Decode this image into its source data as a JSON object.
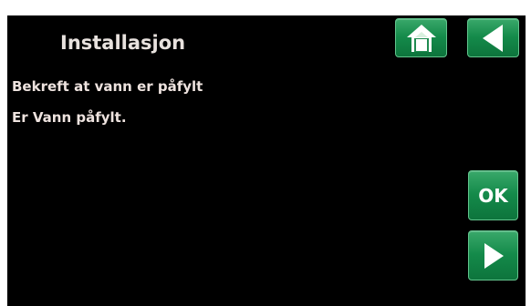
{
  "screen": {
    "title": "Installasjon",
    "message_line_1": "Bekreft at vann er påfylt",
    "message_line_2": "Er Vann påfylt."
  },
  "buttons": {
    "home_icon": "home-icon",
    "back_icon": "triangle-left-icon",
    "ok_label": "OK",
    "next_icon": "triangle-right-icon"
  },
  "colors": {
    "background": "#000000",
    "text": "#eee3df",
    "button_green": "#148a4a",
    "button_border": "#62c58d",
    "icon": "#ffffff"
  }
}
